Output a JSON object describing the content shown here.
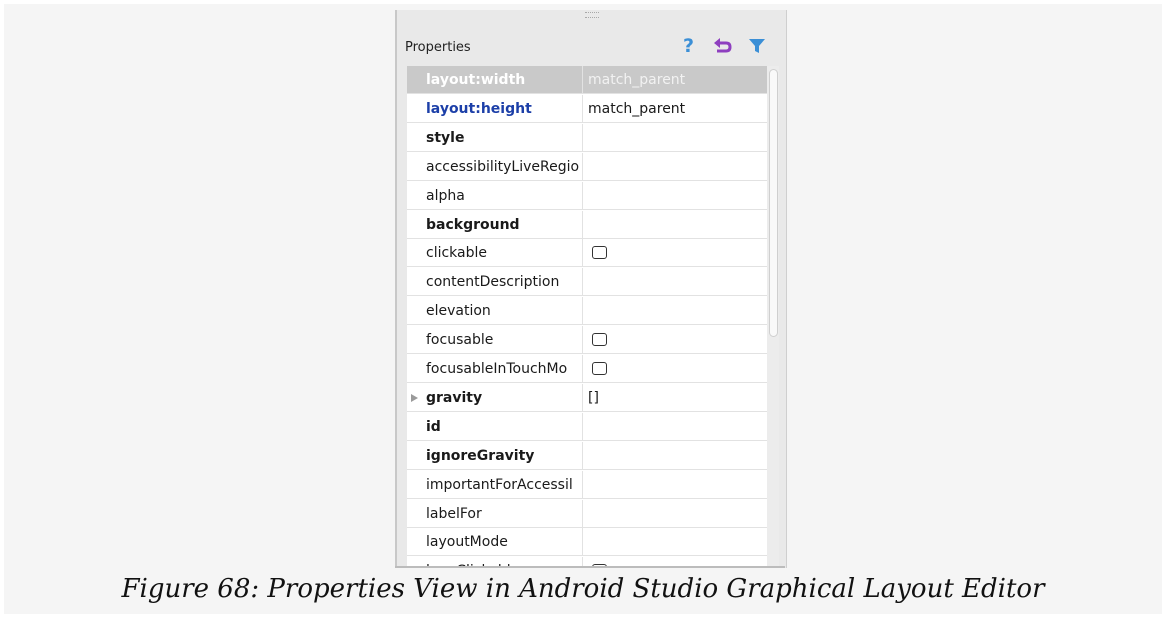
{
  "panel": {
    "title": "Properties",
    "toolbar": [
      {
        "icon": "help-icon",
        "label": "?"
      },
      {
        "icon": "undo-icon"
      },
      {
        "icon": "filter-icon"
      }
    ]
  },
  "properties": [
    {
      "name": "layout:width",
      "value": "match_parent",
      "style": "selected"
    },
    {
      "name": "layout:height",
      "value": "match_parent",
      "style": "blue"
    },
    {
      "name": "style",
      "value": "",
      "style": "bold"
    },
    {
      "name": "accessibilityLiveRegio",
      "value": "",
      "style": "normal"
    },
    {
      "name": "alpha",
      "value": "",
      "style": "normal"
    },
    {
      "name": "background",
      "value": "",
      "style": "bold"
    },
    {
      "name": "clickable",
      "value": "",
      "style": "normal",
      "checkbox": true
    },
    {
      "name": "contentDescription",
      "value": "",
      "style": "normal"
    },
    {
      "name": "elevation",
      "value": "",
      "style": "normal"
    },
    {
      "name": "focusable",
      "value": "",
      "style": "normal",
      "checkbox": true
    },
    {
      "name": "focusableInTouchMo",
      "value": "",
      "style": "normal",
      "checkbox": true
    },
    {
      "name": "gravity",
      "value": "[]",
      "style": "bold",
      "expandable": true
    },
    {
      "name": "id",
      "value": "",
      "style": "bold"
    },
    {
      "name": "ignoreGravity",
      "value": "",
      "style": "bold"
    },
    {
      "name": "importantForAccessil",
      "value": "",
      "style": "normal"
    },
    {
      "name": "labelFor",
      "value": "",
      "style": "normal"
    },
    {
      "name": "layoutMode",
      "value": "",
      "style": "normal"
    },
    {
      "name": "longClickable",
      "value": "",
      "style": "normal",
      "checkbox": true
    }
  ],
  "colors": {
    "accent_icon": "#3b8fd6",
    "undo_icon": "#8e3fbf",
    "selected_row": "#c9c9c9",
    "modified_name": "#1c3fa8"
  },
  "caption": "Figure 68: Properties View in Android Studio Graphical Layout Editor"
}
